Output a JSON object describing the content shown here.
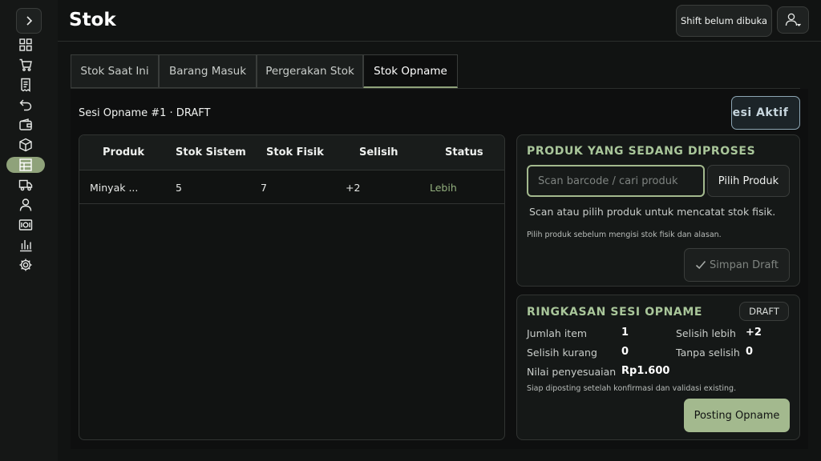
{
  "header": {
    "title": "Stok",
    "shift_label": "Shift belum dibuka"
  },
  "sidebar": {
    "items": [
      "grid-icon",
      "cart-icon",
      "receipt-icon",
      "undo-icon",
      "wallet-icon",
      "box-icon",
      "table-icon",
      "truck-icon",
      "user-icon",
      "cash-icon",
      "chart-icon",
      "gear-icon"
    ],
    "active_index": 6
  },
  "tabs": [
    {
      "label": "Stok Saat Ini"
    },
    {
      "label": "Barang Masuk"
    },
    {
      "label": "Pergerakan Stok"
    },
    {
      "label": "Stok Opname",
      "active": true
    }
  ],
  "session": {
    "label": "Sesi Opname #1 · DRAFT",
    "active_button": "Sesi Aktif"
  },
  "table": {
    "headers": [
      "Produk",
      "Stok Sistem",
      "Stok Fisik",
      "Selisih",
      "Status"
    ],
    "rows": [
      {
        "produk": "Minyak ...",
        "sistem": "5",
        "fisik": "7",
        "selisih": "+2",
        "status": "Lebih"
      }
    ]
  },
  "process": {
    "title": "PRODUK YANG SEDANG DIPROSES",
    "search_placeholder": "Scan barcode / cari produk",
    "pick_button": "Pilih Produk",
    "help": "Scan atau pilih produk untuk mencatat stok fisik.",
    "note": "Pilih produk sebelum mengisi stok fisik dan alasan.",
    "save_button": "Simpan Draft"
  },
  "summary": {
    "title": "RINGKASAN SESI OPNAME",
    "badge": "DRAFT",
    "jumlah_label": "Jumlah item",
    "jumlah_value": "1",
    "lebih_label": "Selisih lebih",
    "lebih_value": "+2",
    "kurang_label": "Selisih kurang",
    "kurang_value": "0",
    "tanpa_label": "Tanpa selisih",
    "tanpa_value": "0",
    "nilai_label": "Nilai penyesuaian",
    "nilai_value": "Rp1.600",
    "note": "Siap diposting setelah konfirmasi dan validasi existing.",
    "post_button": "Posting Opname"
  },
  "colors": {
    "accent": "#a3b98e",
    "background": "#111312"
  }
}
